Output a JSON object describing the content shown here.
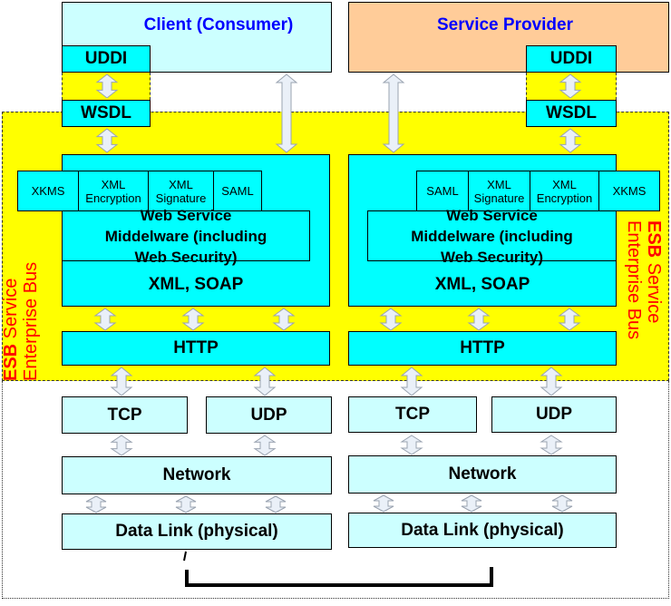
{
  "client": {
    "title": "Client (Consumer)",
    "uddi": "UDDI",
    "wsdl": "WSDL",
    "security": [
      "XKMS",
      "XML Encryption",
      "XML Signature",
      "SAML"
    ],
    "middleware": "Web Service Middelware (including Web Security)",
    "soap": "XML, SOAP",
    "http": "HTTP",
    "tcp": "TCP",
    "udp": "UDP",
    "network": "Network",
    "datalink": "Data Link (physical)"
  },
  "provider": {
    "title": "Service Provider",
    "uddi": "UDDI",
    "wsdl": "WSDL",
    "security": [
      "SAML",
      "XML Signature",
      "XML Encryption",
      "XKMS"
    ],
    "middleware": "Web Service Middelware (including Web Security)",
    "soap": "XML, SOAP",
    "http": "HTTP",
    "tcp": "TCP",
    "udp": "UDP",
    "network": "Network",
    "datalink": "Data Link (physical)"
  },
  "esb": {
    "bold": "ESB",
    "line1": "Service",
    "line2": "Enterprise Bus"
  },
  "colors": {
    "client": "#ccffff",
    "provider": "#ffcc99",
    "layer": "#00ffff",
    "lower": "#ccffff",
    "esb": "#ffff00",
    "title": "#0000ff",
    "esb_text": "#ff0000"
  }
}
